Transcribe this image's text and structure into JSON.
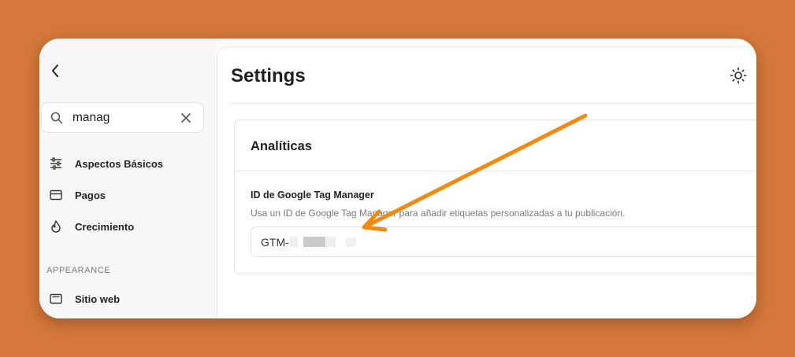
{
  "sidebar": {
    "search": {
      "value": "manag"
    },
    "items": [
      {
        "label": "Aspectos Básicos",
        "icon": "sliders-icon"
      },
      {
        "label": "Pagos",
        "icon": "credit-card-icon"
      },
      {
        "label": "Crecimiento",
        "icon": "flame-icon"
      }
    ],
    "section_heading": "APPEARANCE",
    "appearance_items": [
      {
        "label": "Sitio web",
        "icon": "browser-window-icon"
      }
    ]
  },
  "main": {
    "title": "Settings",
    "card": {
      "title": "Analíticas",
      "field": {
        "label": "ID de Google Tag Manager",
        "help": "Usa un ID de Google Tag Manager para añadir etiquetas personalizadas a tu publicación.",
        "value": "GTM-"
      }
    }
  },
  "colors": {
    "background": "#d4773a",
    "arrow": "#f28a10"
  }
}
